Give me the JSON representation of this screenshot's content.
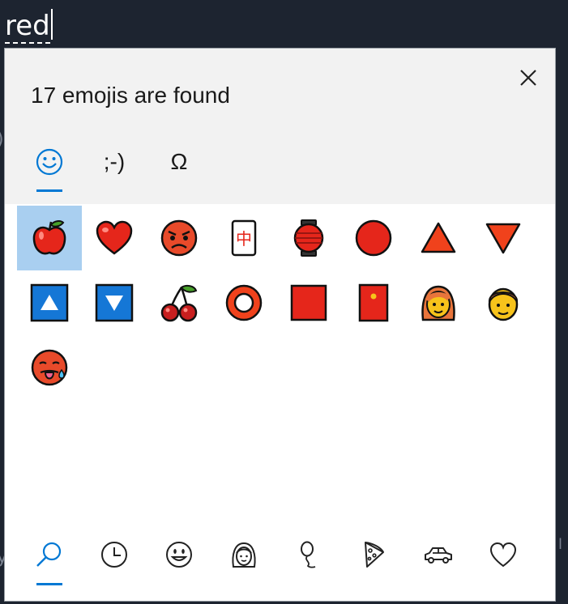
{
  "input": {
    "typed_text": "red"
  },
  "panel": {
    "title": "17 emojis are found",
    "tabs": [
      {
        "name": "emoji-tab",
        "icon": "smiley-icon"
      },
      {
        "name": "kaomoji-tab",
        "label": ";-)"
      },
      {
        "name": "symbols-tab",
        "label": "Ω"
      }
    ],
    "selected_tab": "emoji-tab",
    "emojis": [
      {
        "name": "red apple"
      },
      {
        "name": "red heart"
      },
      {
        "name": "pouting face"
      },
      {
        "name": "mahjong red dragon",
        "glyph": "中"
      },
      {
        "name": "red paper lantern"
      },
      {
        "name": "red circle"
      },
      {
        "name": "red triangle pointed up"
      },
      {
        "name": "red triangle pointed down"
      },
      {
        "name": "up button"
      },
      {
        "name": "down button"
      },
      {
        "name": "cherries"
      },
      {
        "name": "hollow red circle"
      },
      {
        "name": "red square"
      },
      {
        "name": "red envelope"
      },
      {
        "name": "woman red hair"
      },
      {
        "name": "man red hair"
      },
      {
        "name": "hot face"
      }
    ],
    "selected_emoji": 0,
    "bottom_nav": [
      {
        "name": "search-icon"
      },
      {
        "name": "recent-clock-icon"
      },
      {
        "name": "smiley-face-icon"
      },
      {
        "name": "people-icon"
      },
      {
        "name": "balloon-icon"
      },
      {
        "name": "pizza-icon"
      },
      {
        "name": "car-icon"
      },
      {
        "name": "heart-icon"
      }
    ],
    "selected_nav": "search-icon"
  },
  "colors": {
    "accent": "#0078d4",
    "selection": "#a9cff0",
    "header_bg": "#f2f2f2",
    "backdrop": "#1d2430"
  }
}
